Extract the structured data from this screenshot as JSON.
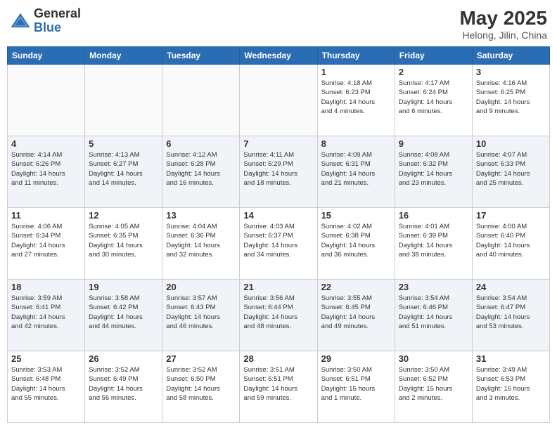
{
  "logo": {
    "general": "General",
    "blue": "Blue"
  },
  "title": {
    "month_year": "May 2025",
    "location": "Helong, Jilin, China"
  },
  "days_of_week": [
    "Sunday",
    "Monday",
    "Tuesday",
    "Wednesday",
    "Thursday",
    "Friday",
    "Saturday"
  ],
  "weeks": [
    [
      {
        "day": "",
        "info": ""
      },
      {
        "day": "",
        "info": ""
      },
      {
        "day": "",
        "info": ""
      },
      {
        "day": "",
        "info": ""
      },
      {
        "day": "1",
        "info": "Sunrise: 4:18 AM\nSunset: 6:23 PM\nDaylight: 14 hours\nand 4 minutes."
      },
      {
        "day": "2",
        "info": "Sunrise: 4:17 AM\nSunset: 6:24 PM\nDaylight: 14 hours\nand 6 minutes."
      },
      {
        "day": "3",
        "info": "Sunrise: 4:16 AM\nSunset: 6:25 PM\nDaylight: 14 hours\nand 9 minutes."
      }
    ],
    [
      {
        "day": "4",
        "info": "Sunrise: 4:14 AM\nSunset: 6:26 PM\nDaylight: 14 hours\nand 11 minutes."
      },
      {
        "day": "5",
        "info": "Sunrise: 4:13 AM\nSunset: 6:27 PM\nDaylight: 14 hours\nand 14 minutes."
      },
      {
        "day": "6",
        "info": "Sunrise: 4:12 AM\nSunset: 6:28 PM\nDaylight: 14 hours\nand 16 minutes."
      },
      {
        "day": "7",
        "info": "Sunrise: 4:11 AM\nSunset: 6:29 PM\nDaylight: 14 hours\nand 18 minutes."
      },
      {
        "day": "8",
        "info": "Sunrise: 4:09 AM\nSunset: 6:31 PM\nDaylight: 14 hours\nand 21 minutes."
      },
      {
        "day": "9",
        "info": "Sunrise: 4:08 AM\nSunset: 6:32 PM\nDaylight: 14 hours\nand 23 minutes."
      },
      {
        "day": "10",
        "info": "Sunrise: 4:07 AM\nSunset: 6:33 PM\nDaylight: 14 hours\nand 25 minutes."
      }
    ],
    [
      {
        "day": "11",
        "info": "Sunrise: 4:06 AM\nSunset: 6:34 PM\nDaylight: 14 hours\nand 27 minutes."
      },
      {
        "day": "12",
        "info": "Sunrise: 4:05 AM\nSunset: 6:35 PM\nDaylight: 14 hours\nand 30 minutes."
      },
      {
        "day": "13",
        "info": "Sunrise: 4:04 AM\nSunset: 6:36 PM\nDaylight: 14 hours\nand 32 minutes."
      },
      {
        "day": "14",
        "info": "Sunrise: 4:03 AM\nSunset: 6:37 PM\nDaylight: 14 hours\nand 34 minutes."
      },
      {
        "day": "15",
        "info": "Sunrise: 4:02 AM\nSunset: 6:38 PM\nDaylight: 14 hours\nand 36 minutes."
      },
      {
        "day": "16",
        "info": "Sunrise: 4:01 AM\nSunset: 6:39 PM\nDaylight: 14 hours\nand 38 minutes."
      },
      {
        "day": "17",
        "info": "Sunrise: 4:00 AM\nSunset: 6:40 PM\nDaylight: 14 hours\nand 40 minutes."
      }
    ],
    [
      {
        "day": "18",
        "info": "Sunrise: 3:59 AM\nSunset: 6:41 PM\nDaylight: 14 hours\nand 42 minutes."
      },
      {
        "day": "19",
        "info": "Sunrise: 3:58 AM\nSunset: 6:42 PM\nDaylight: 14 hours\nand 44 minutes."
      },
      {
        "day": "20",
        "info": "Sunrise: 3:57 AM\nSunset: 6:43 PM\nDaylight: 14 hours\nand 46 minutes."
      },
      {
        "day": "21",
        "info": "Sunrise: 3:56 AM\nSunset: 6:44 PM\nDaylight: 14 hours\nand 48 minutes."
      },
      {
        "day": "22",
        "info": "Sunrise: 3:55 AM\nSunset: 6:45 PM\nDaylight: 14 hours\nand 49 minutes."
      },
      {
        "day": "23",
        "info": "Sunrise: 3:54 AM\nSunset: 6:46 PM\nDaylight: 14 hours\nand 51 minutes."
      },
      {
        "day": "24",
        "info": "Sunrise: 3:54 AM\nSunset: 6:47 PM\nDaylight: 14 hours\nand 53 minutes."
      }
    ],
    [
      {
        "day": "25",
        "info": "Sunrise: 3:53 AM\nSunset: 6:48 PM\nDaylight: 14 hours\nand 55 minutes."
      },
      {
        "day": "26",
        "info": "Sunrise: 3:52 AM\nSunset: 6:49 PM\nDaylight: 14 hours\nand 56 minutes."
      },
      {
        "day": "27",
        "info": "Sunrise: 3:52 AM\nSunset: 6:50 PM\nDaylight: 14 hours\nand 58 minutes."
      },
      {
        "day": "28",
        "info": "Sunrise: 3:51 AM\nSunset: 6:51 PM\nDaylight: 14 hours\nand 59 minutes."
      },
      {
        "day": "29",
        "info": "Sunrise: 3:50 AM\nSunset: 6:51 PM\nDaylight: 15 hours\nand 1 minute."
      },
      {
        "day": "30",
        "info": "Sunrise: 3:50 AM\nSunset: 6:52 PM\nDaylight: 15 hours\nand 2 minutes."
      },
      {
        "day": "31",
        "info": "Sunrise: 3:49 AM\nSunset: 6:53 PM\nDaylight: 15 hours\nand 3 minutes."
      }
    ]
  ]
}
